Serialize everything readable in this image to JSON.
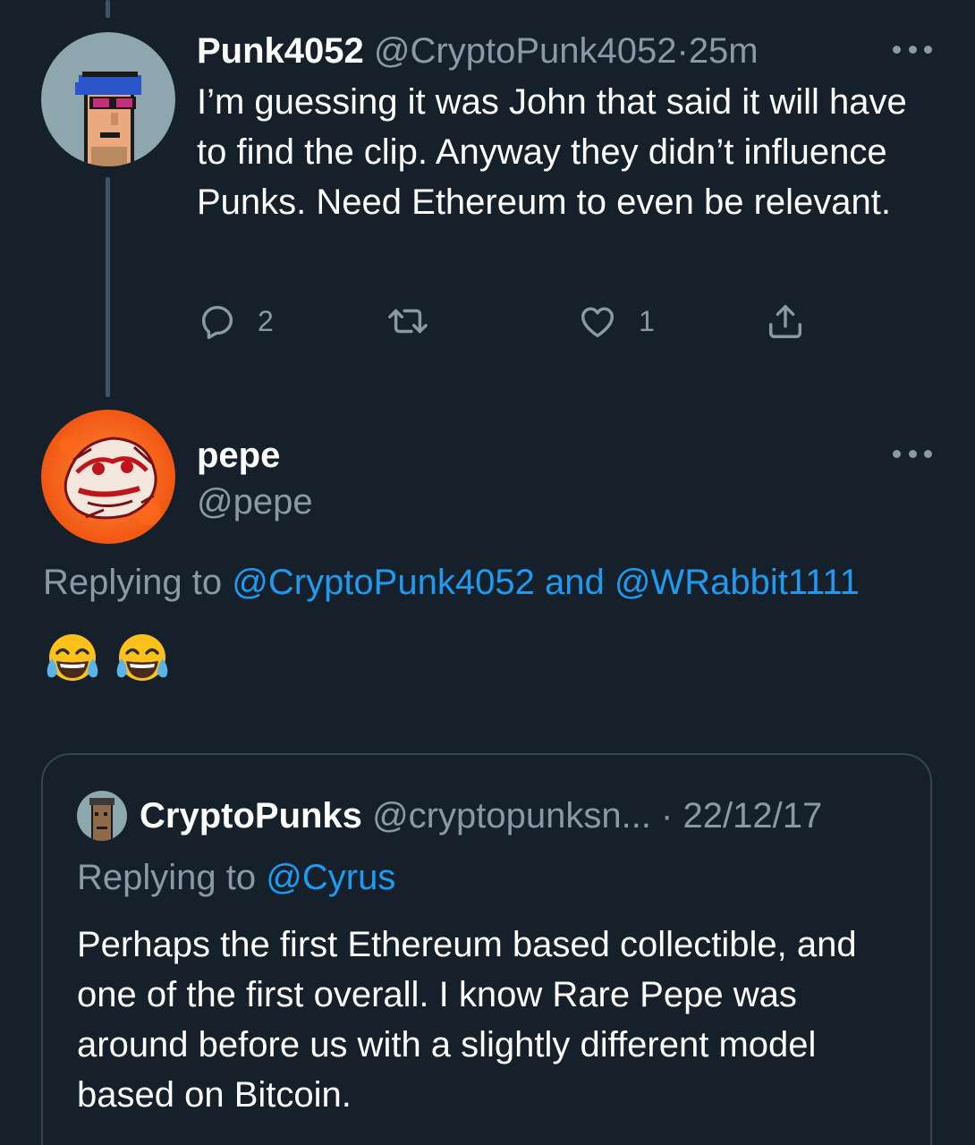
{
  "tweet1": {
    "name": "Punk4052",
    "handle": "@CryptoPunk4052",
    "separator": "·",
    "time": "25m",
    "text": "I’m guessing it was John that said it will have to find the clip. Anyway they didn’t influence Punks. Need Ethereum to even be relevant.",
    "reply_count": "2",
    "like_count": "1"
  },
  "tweet2": {
    "name": "pepe",
    "handle": "@pepe",
    "replying_prefix": "Replying to",
    "replying_user1": "@CryptoPunk4052",
    "replying_and": "and",
    "replying_user2": "@WRabbit1111",
    "emoji": "😂😂"
  },
  "quote": {
    "name": "CryptoPunks",
    "handle": "@cryptopunksn...",
    "separator": "·",
    "date": "22/12/17",
    "replying_prefix": "Replying to",
    "replying_user": "@Cyrus",
    "text": "Perhaps the first Ethereum based collectible, and one of the first overall. I know Rare Pepe was around before us with a slightly different model based on Bitcoin."
  },
  "colors": {
    "background": "#15202b",
    "text": "#ffffff",
    "muted": "#8b98a5",
    "link": "#1d9bf0",
    "border": "#38444d"
  },
  "icons": [
    "reply-icon",
    "retweet-icon",
    "like-icon",
    "share-icon",
    "more-icon"
  ]
}
